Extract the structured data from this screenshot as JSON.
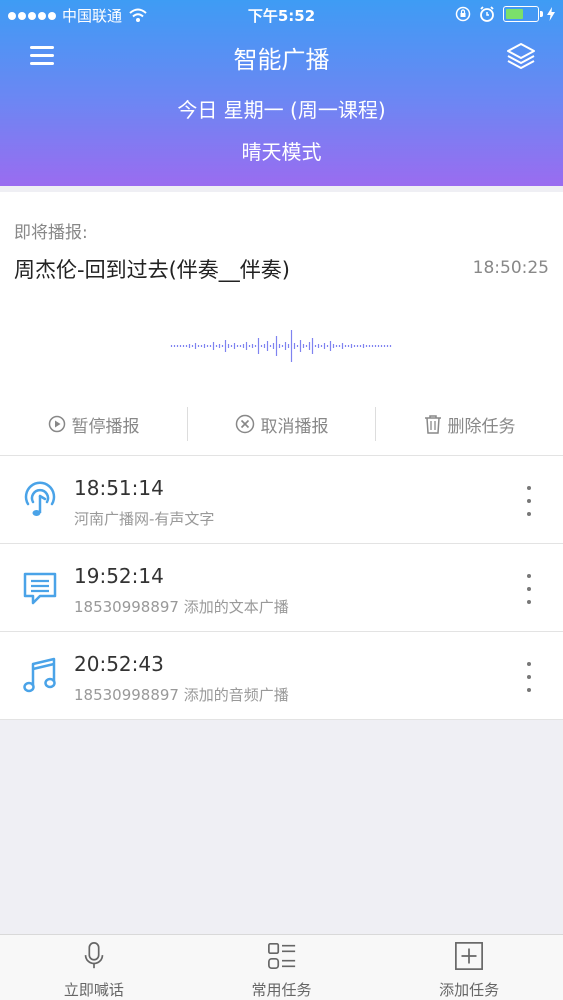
{
  "status_bar": {
    "carrier": "中国联通",
    "time": "下午5:52",
    "signal_bars": 5,
    "battery_level": 0.6
  },
  "header": {
    "title": "智能广播",
    "day_line": "今日 星期一 (周一课程)",
    "mode_line": "晴天模式"
  },
  "now_playing": {
    "label": "即将播报:",
    "title": "周杰伦-回到过去(伴奏__伴奏)",
    "time": "18:50:25"
  },
  "actions": {
    "pause": "暂停播报",
    "cancel": "取消播报",
    "delete": "删除任务"
  },
  "tasks": [
    {
      "time": "18:51:14",
      "desc": "河南广播网-有声文字",
      "icon": "radio-broadcast-icon"
    },
    {
      "time": "19:52:14",
      "desc": "18530998897 添加的文本广播",
      "icon": "text-message-icon"
    },
    {
      "time": "20:52:43",
      "desc": "18530998897 添加的音频广播",
      "icon": "music-note-icon"
    }
  ],
  "tabbar": {
    "items": [
      {
        "label": "立即喊话",
        "icon": "microphone-icon"
      },
      {
        "label": "常用任务",
        "icon": "task-list-icon"
      },
      {
        "label": "添加任务",
        "icon": "add-square-icon"
      }
    ]
  },
  "colors": {
    "header_top": "#3e9cf4",
    "header_bottom": "#9a6cf0",
    "accent_blue": "#4aa3e8",
    "waveform": "#7f83f0"
  }
}
